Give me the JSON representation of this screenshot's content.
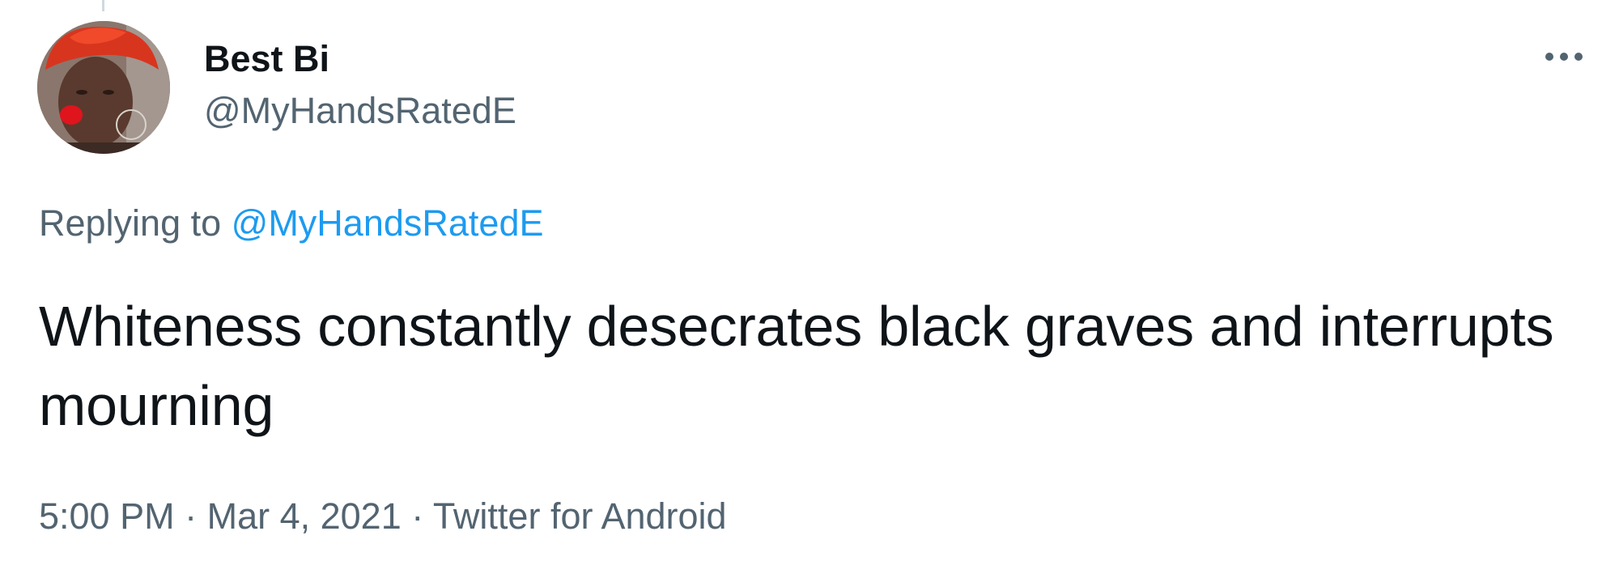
{
  "author": {
    "display_name": "Best Bi",
    "handle": "@MyHandsRatedE",
    "avatar_icon": "profile-photo"
  },
  "reply": {
    "prefix": "Replying to ",
    "mention": "@MyHandsRatedE"
  },
  "tweet": {
    "text": "Whiteness constantly desecrates black graves and interrupts mourning"
  },
  "meta": {
    "time": "5:00 PM",
    "separator": " · ",
    "date": "Mar 4, 2021",
    "source": "Twitter for Android"
  },
  "icons": {
    "more": "more-options-icon"
  },
  "colors": {
    "text_primary": "#0f1419",
    "text_secondary": "#536471",
    "link": "#1d9bf0"
  }
}
